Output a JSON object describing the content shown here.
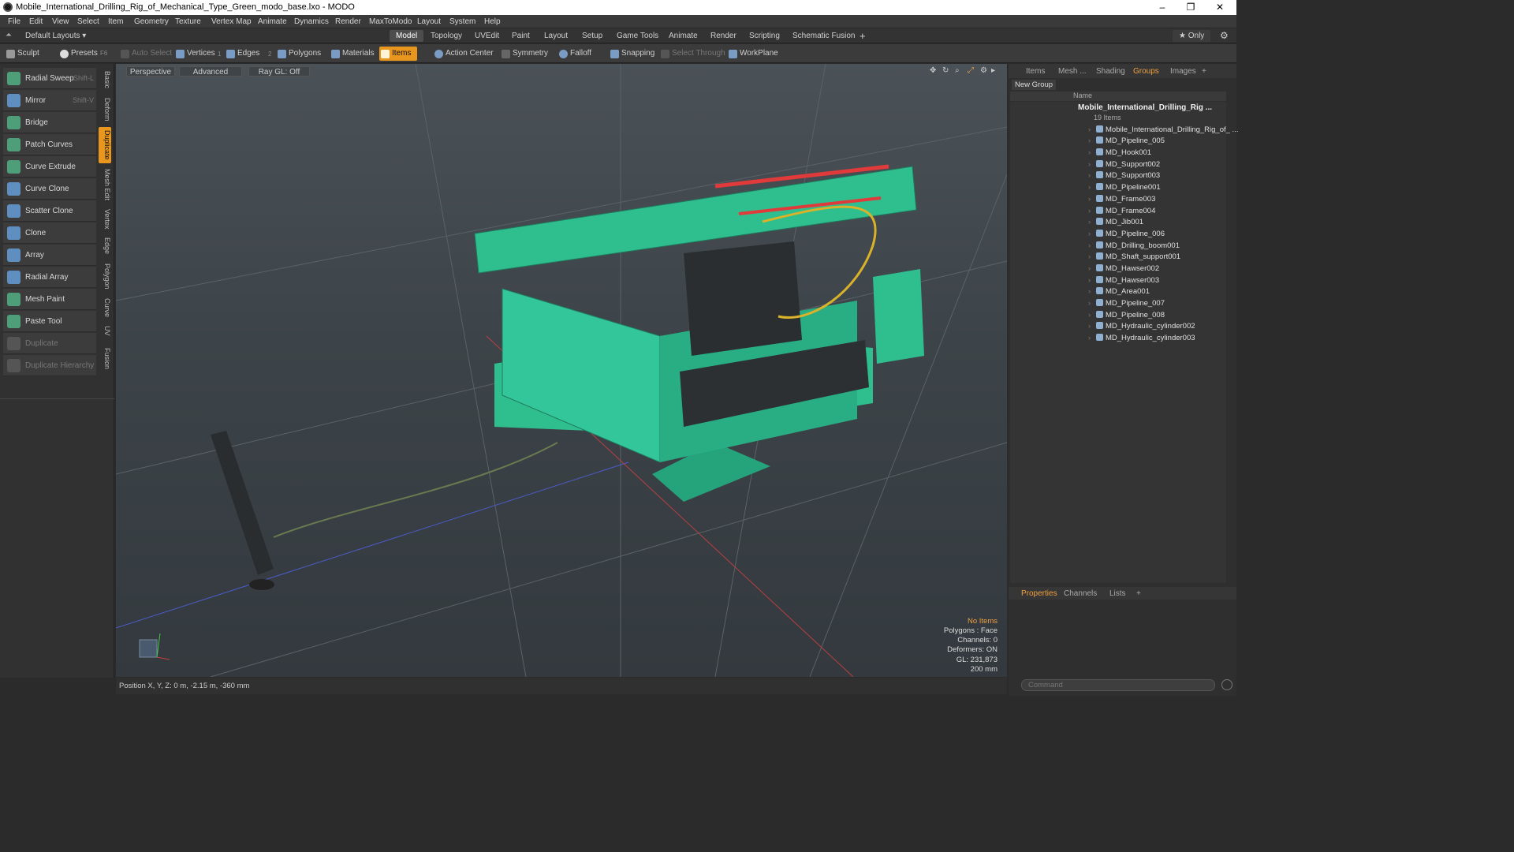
{
  "window": {
    "title": "Mobile_International_Drilling_Rig_of_Mechanical_Type_Green_modo_base.lxo - MODO",
    "min": "–",
    "max": "❐",
    "close": "✕"
  },
  "menu": [
    "File",
    "Edit",
    "View",
    "Select",
    "Item",
    "Geometry",
    "Texture",
    "Vertex Map",
    "Animate",
    "Dynamics",
    "Render",
    "MaxToModo",
    "Layout",
    "System",
    "Help"
  ],
  "layouts": {
    "selector": "Default Layouts ▾",
    "tabs": [
      "Model",
      "Topology",
      "UVEdit",
      "Paint",
      "Layout",
      "Setup",
      "Game Tools",
      "Animate",
      "Render",
      "Scripting",
      "Schematic Fusion"
    ],
    "plus": "+",
    "only": "★ Only"
  },
  "toolbar": {
    "sculpt": "Sculpt",
    "presets": "Presets",
    "presets_key": "F6",
    "auto_select": "Auto Select",
    "vertices": "Vertices",
    "vertices_count": "1",
    "edges": "Edges",
    "edges_count": "2",
    "polygons": "Polygons",
    "materials": "Materials",
    "items": "Items",
    "action_center": "Action Center",
    "symmetry": "Symmetry",
    "falloff": "Falloff",
    "snapping": "Snapping",
    "select_through": "Select Through",
    "workplane": "WorkPlane"
  },
  "tools": [
    {
      "label": "Radial Sweep",
      "shortcut": "Shift-L"
    },
    {
      "label": "Mirror",
      "shortcut": "Shift-V"
    },
    {
      "label": "Bridge",
      "shortcut": ""
    },
    {
      "label": "Patch Curves",
      "shortcut": ""
    },
    {
      "label": "Curve Extrude",
      "shortcut": ""
    },
    {
      "label": "Curve Clone",
      "shortcut": ""
    },
    {
      "label": "Scatter Clone",
      "shortcut": ""
    },
    {
      "label": "Clone",
      "shortcut": ""
    },
    {
      "label": "Array",
      "shortcut": ""
    },
    {
      "label": "Radial Array",
      "shortcut": ""
    },
    {
      "label": "Mesh Paint",
      "shortcut": ""
    },
    {
      "label": "Paste Tool",
      "shortcut": ""
    },
    {
      "label": "Duplicate",
      "shortcut": ""
    },
    {
      "label": "Duplicate Hierarchy",
      "shortcut": ""
    }
  ],
  "side_tabs": [
    "Basic",
    "Deform",
    "Duplicate",
    "Mesh Edit",
    "Vertex",
    "Edge",
    "Polygon",
    "Curve",
    "UV",
    "Fusion"
  ],
  "viewport": {
    "view": "Perspective",
    "mode": "Advanced",
    "raygl": "Ray GL: Off"
  },
  "stats": {
    "selection": "No Items",
    "polygons": "Polygons : Face",
    "channels": "Channels: 0",
    "deformers": "Deformers: ON",
    "gl": "GL: 231,873",
    "scale": "200 mm"
  },
  "status": "Position X, Y, Z:  0 m, -2.15 m, -360 mm",
  "right": {
    "tabs": [
      "Items",
      "Mesh ...",
      "Shading",
      "Groups",
      "Images",
      "+"
    ],
    "new_group": "New Group",
    "name_header": "Name",
    "group_name": "Mobile_International_Drilling_Rig ...",
    "group_count": "19 Items",
    "items": [
      "Mobile_International_Drilling_Rig_of_ ...",
      "MD_Pipeline_005",
      "MD_Hook001",
      "MD_Support002",
      "MD_Support003",
      "MD_Pipeline001",
      "MD_Frame003",
      "MD_Frame004",
      "MD_Jib001",
      "MD_Pipeline_006",
      "MD_Drilling_boom001",
      "MD_Shaft_support001",
      "MD_Hawser002",
      "MD_Hawser003",
      "MD_Area001",
      "MD_Pipeline_007",
      "MD_Pipeline_008",
      "MD_Hydraulic_cylinder002",
      "MD_Hydraulic_cylinder003"
    ],
    "bottom_tabs": [
      "Properties",
      "Channels",
      "Lists",
      "+"
    ],
    "command_placeholder": "Command"
  },
  "colors": {
    "accent": "#e8961e",
    "rig_green": "#2fbf8f"
  }
}
